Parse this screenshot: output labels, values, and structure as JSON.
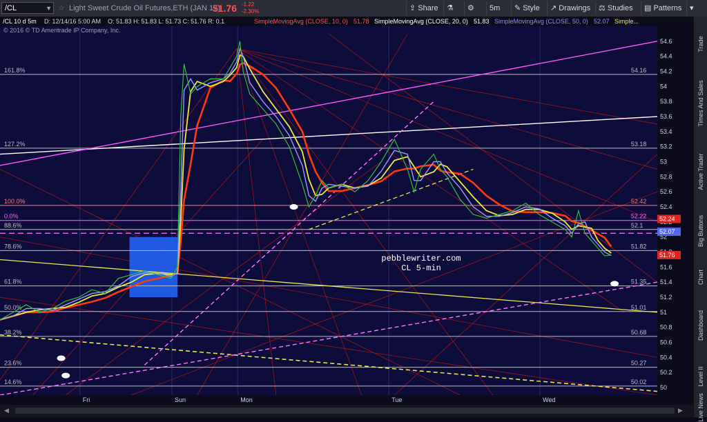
{
  "toolbar": {
    "symbol": "/CL",
    "description": "Light Sweet Crude Oil Futures,ETH (JAN 17)",
    "last": "51.76",
    "change": "-1.22",
    "change_pct": "-2.30%",
    "share": "Share",
    "timeframe": "5m",
    "style": "Style",
    "drawings": "Drawings",
    "studies": "Studies",
    "patterns": "Patterns"
  },
  "infobar": {
    "title": "/CL 10 d 5m",
    "date": "D: 12/14/16 5:00 AM",
    "ohlc": "O: 51.83  H: 51.83  L: 51.73  C: 51.76  R: 0.1",
    "sma10": "SimpleMovingAvg (CLOSE, 10, 0)",
    "sma10_val": "51.78",
    "sma20": "SimpleMovingAvg (CLOSE, 20, 0)",
    "sma20_val": "51.83",
    "sma50": "SimpleMovingAvg (CLOSE, 50, 0)",
    "sma50_val": "52.07",
    "more": "Simple..."
  },
  "copyright": "© 2016 © TD Ameritrade IP Company, Inc.",
  "watermark": {
    "line1": "pebblewriter.com",
    "line2": "CL 5-min"
  },
  "sidebar": [
    "Trade",
    "Times And Sales",
    "Active Trader",
    "Big Buttons",
    "Chart",
    "Dashboard",
    "Level II",
    "Live News"
  ],
  "chart_data": {
    "type": "line",
    "ylim": [
      49.9,
      54.8
    ],
    "ytick_start": 50,
    "ytick_step": 0.2,
    "yticks": [
      "50",
      "50.2",
      "50.4",
      "50.6",
      "50.8",
      "51",
      "51.2",
      "51.4",
      "51.6",
      "51.8",
      "52",
      "52.2",
      "52.4",
      "52.6",
      "52.8",
      "53",
      "53.2",
      "53.4",
      "53.6",
      "53.8",
      "54",
      "54.2",
      "54.4",
      "54.6"
    ],
    "x_labels": [
      {
        "t": 0.13,
        "label": "Fri"
      },
      {
        "t": 0.27,
        "label": "Sun"
      },
      {
        "t": 0.37,
        "label": "Mon"
      },
      {
        "t": 0.6,
        "label": "Tue"
      },
      {
        "t": 0.83,
        "label": "Wed"
      }
    ],
    "levels": [
      {
        "y": 54.16,
        "left": "161.8%",
        "right": "54.16",
        "color": "#b8bcc8"
      },
      {
        "y": 53.18,
        "left": "127.2%",
        "right": "53.18",
        "color": "#b8bcc8"
      },
      {
        "y": 52.42,
        "left": "100.0%",
        "right": "52.42",
        "color": "#ff7b7b"
      },
      {
        "y": 52.22,
        "left": "0.0%",
        "right": "52.22",
        "color": "#ff66ff"
      },
      {
        "y": 52.1,
        "left": "88.6%",
        "right": "52.1",
        "color": "#b8bcc8"
      },
      {
        "y": 51.82,
        "left": "78.6%",
        "right": "51.82",
        "color": "#b8bcc8"
      },
      {
        "y": 51.35,
        "left": "61.8%",
        "right": "51.35",
        "color": "#b8bcc8"
      },
      {
        "y": 51.01,
        "left": "50.0%",
        "right": "51.01",
        "color": "#b8bcc8"
      },
      {
        "y": 50.68,
        "left": "38.2%",
        "right": "50.68",
        "color": "#b8bcc8"
      },
      {
        "y": 50.27,
        "left": "23.6%",
        "right": "50.27",
        "color": "#b8bcc8"
      },
      {
        "y": 50.02,
        "left": "14.6%",
        "right": "50.02",
        "color": "#b8bcc8"
      }
    ],
    "badges": [
      {
        "y": 52.24,
        "label": "52.24",
        "color": "#e02424"
      },
      {
        "y": 52.07,
        "label": "52.07",
        "color": "#5566ee"
      },
      {
        "y": 51.76,
        "label": "51.76",
        "color": "#e02424"
      }
    ],
    "price": {
      "t": [
        0,
        0.02,
        0.04,
        0.06,
        0.08,
        0.1,
        0.12,
        0.14,
        0.16,
        0.18,
        0.2,
        0.22,
        0.24,
        0.26,
        0.27,
        0.275,
        0.28,
        0.29,
        0.3,
        0.32,
        0.34,
        0.35,
        0.36,
        0.365,
        0.37,
        0.38,
        0.4,
        0.42,
        0.44,
        0.46,
        0.47,
        0.48,
        0.49,
        0.5,
        0.52,
        0.54,
        0.56,
        0.58,
        0.6,
        0.62,
        0.63,
        0.64,
        0.66,
        0.67,
        0.68,
        0.7,
        0.72,
        0.74,
        0.76,
        0.78,
        0.8,
        0.82,
        0.84,
        0.86,
        0.87,
        0.88,
        0.89,
        0.9,
        0.91,
        0.92,
        0.93
      ],
      "y": [
        50.9,
        51.0,
        51.1,
        51.0,
        51.05,
        51.15,
        51.2,
        51.3,
        51.25,
        51.45,
        51.5,
        51.55,
        51.5,
        51.45,
        51.6,
        53.6,
        54.3,
        53.9,
        54.0,
        54.1,
        54.1,
        54.25,
        54.4,
        54.6,
        54.2,
        53.9,
        53.7,
        53.5,
        53.2,
        52.7,
        52.4,
        52.55,
        52.75,
        52.65,
        52.7,
        52.6,
        52.75,
        53.0,
        53.3,
        52.9,
        52.6,
        52.9,
        53.1,
        52.9,
        52.8,
        52.5,
        52.3,
        52.25,
        52.3,
        52.35,
        52.45,
        52.3,
        52.2,
        52.1,
        52.0,
        52.35,
        52.05,
        51.95,
        51.85,
        51.75,
        51.76
      ]
    }
  }
}
